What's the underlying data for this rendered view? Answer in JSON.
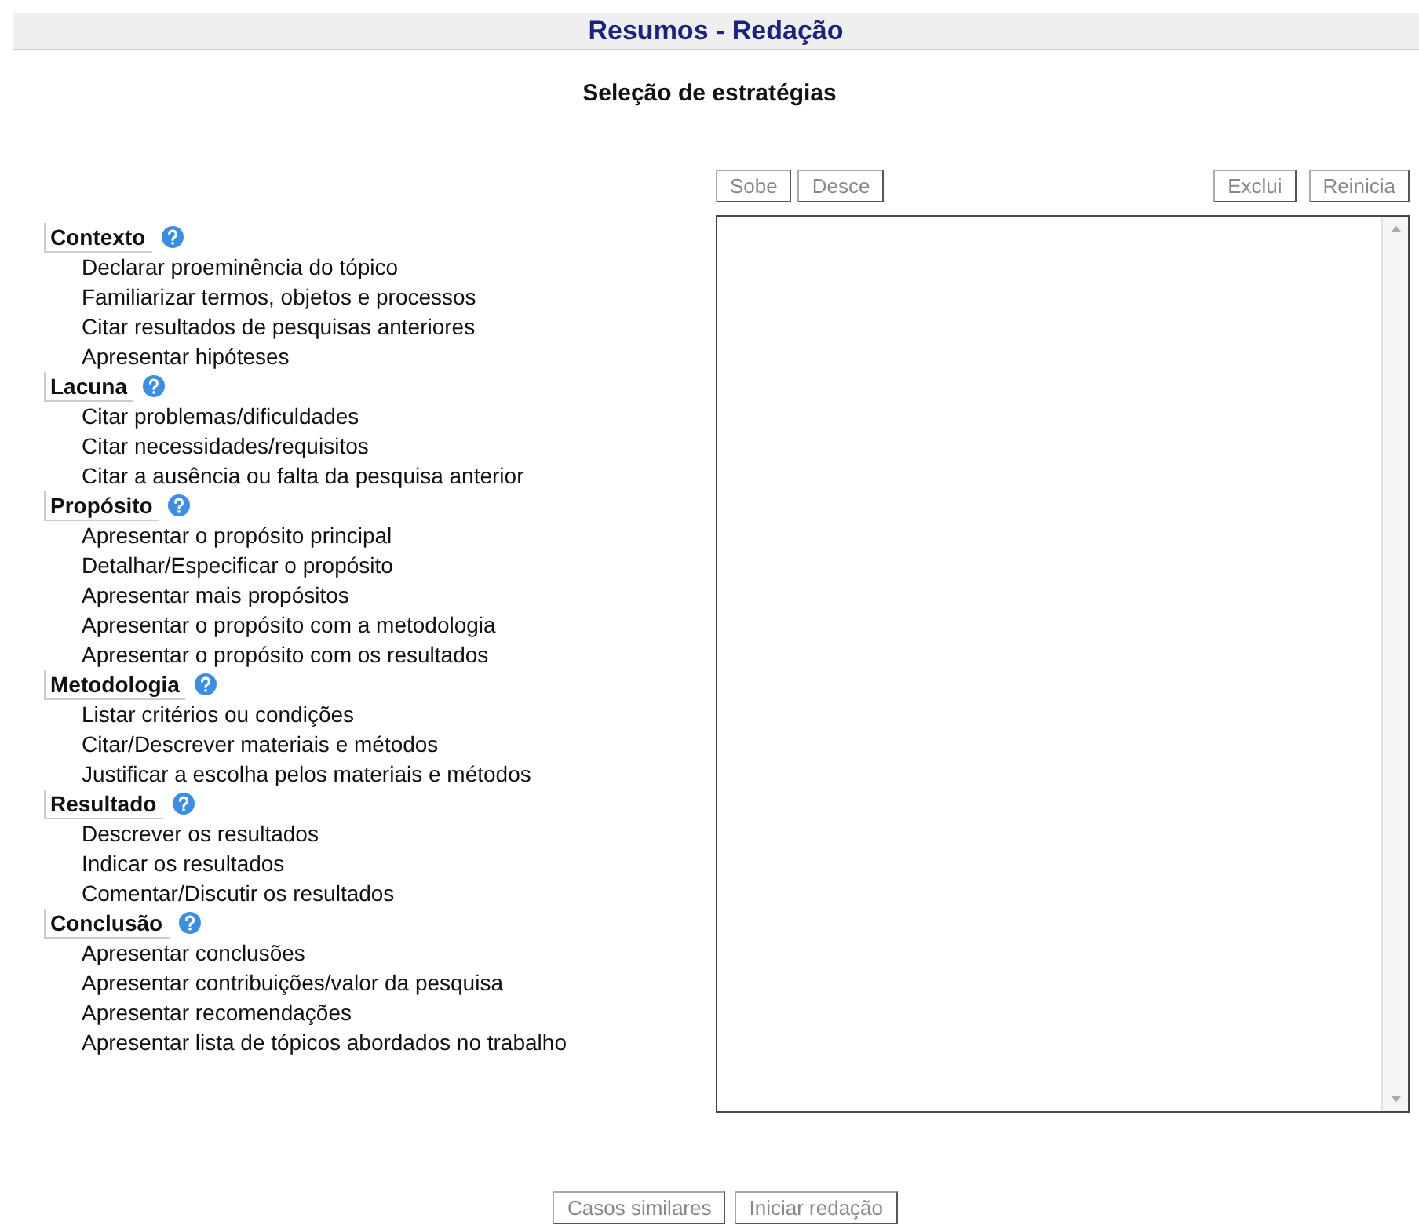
{
  "header": {
    "title": "Resumos - Redação"
  },
  "subtitle": "Seleção de estratégias",
  "list_buttons": [
    {
      "label": "Sobe",
      "disabled": true
    },
    {
      "label": "Desce",
      "disabled": true
    },
    {
      "label": "Exclui",
      "disabled": true
    },
    {
      "label": "Reinicia",
      "disabled": true
    }
  ],
  "categories": [
    {
      "label": "Contexto",
      "children": [
        {
          "label": "Declarar proeminência do tópico"
        },
        {
          "label": "Familiarizar termos, objetos e processos"
        },
        {
          "label": "Citar resultados de pesquisas anteriores"
        },
        {
          "label": "Apresentar hipóteses"
        }
      ]
    },
    {
      "label": "Lacuna",
      "children": [
        {
          "label": "Citar problemas/dificuldades"
        },
        {
          "label": "Citar necessidades/requisitos"
        },
        {
          "label": "Citar a ausência ou falta da pesquisa anterior"
        }
      ]
    },
    {
      "label": "Propósito",
      "children": [
        {
          "label": "Apresentar o propósito principal"
        },
        {
          "label": "Detalhar/Especificar o propósito"
        },
        {
          "label": "Apresentar mais propósitos"
        },
        {
          "label": "Apresentar o propósito com a metodologia"
        },
        {
          "label": "Apresentar o propósito com os resultados"
        }
      ]
    },
    {
      "label": "Metodologia",
      "children": [
        {
          "label": "Listar critérios ou condições"
        },
        {
          "label": "Citar/Descrever materiais e métodos"
        },
        {
          "label": "Justificar a escolha pelos materiais e métodos"
        }
      ]
    },
    {
      "label": "Resultado",
      "children": [
        {
          "label": "Descrever os resultados"
        },
        {
          "label": "Indicar os resultados"
        },
        {
          "label": "Comentar/Discutir os resultados"
        }
      ]
    },
    {
      "label": "Conclusão",
      "children": [
        {
          "label": "Apresentar conclusões"
        },
        {
          "label": "Apresentar contribuições/valor da pesquisa"
        },
        {
          "label": "Apresentar recomendações"
        },
        {
          "label": "Apresentar lista de tópicos abordados no trabalho"
        }
      ]
    }
  ],
  "footer_buttons": [
    {
      "label": "Casos similares",
      "disabled": true
    },
    {
      "label": "Iniciar redação",
      "disabled": true
    }
  ]
}
